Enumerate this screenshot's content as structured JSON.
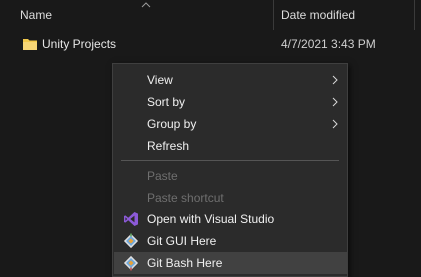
{
  "columns": {
    "name": "Name",
    "date_modified": "Date modified"
  },
  "files": [
    {
      "name": "Unity Projects",
      "date_modified": "4/7/2021 3:43 PM",
      "icon": "folder-icon"
    }
  ],
  "context_menu": {
    "items": [
      {
        "label": "View",
        "has_submenu": true,
        "enabled": true
      },
      {
        "label": "Sort by",
        "has_submenu": true,
        "enabled": true
      },
      {
        "label": "Group by",
        "has_submenu": true,
        "enabled": true
      },
      {
        "label": "Refresh",
        "has_submenu": false,
        "enabled": true
      },
      {
        "label": "Paste",
        "has_submenu": false,
        "enabled": false
      },
      {
        "label": "Paste shortcut",
        "has_submenu": false,
        "enabled": false
      },
      {
        "label": "Open with Visual Studio",
        "icon": "visual-studio-icon",
        "enabled": true
      },
      {
        "label": "Git GUI Here",
        "icon": "git-gui-icon",
        "enabled": true
      },
      {
        "label": "Git Bash Here",
        "icon": "git-bash-icon",
        "enabled": true,
        "highlighted": true
      }
    ]
  },
  "colors": {
    "background": "#191919",
    "menu_background": "#2b2b2b",
    "menu_hover": "#414141",
    "folder": "#f2c94c",
    "visual_studio": "#8c5ad8"
  }
}
